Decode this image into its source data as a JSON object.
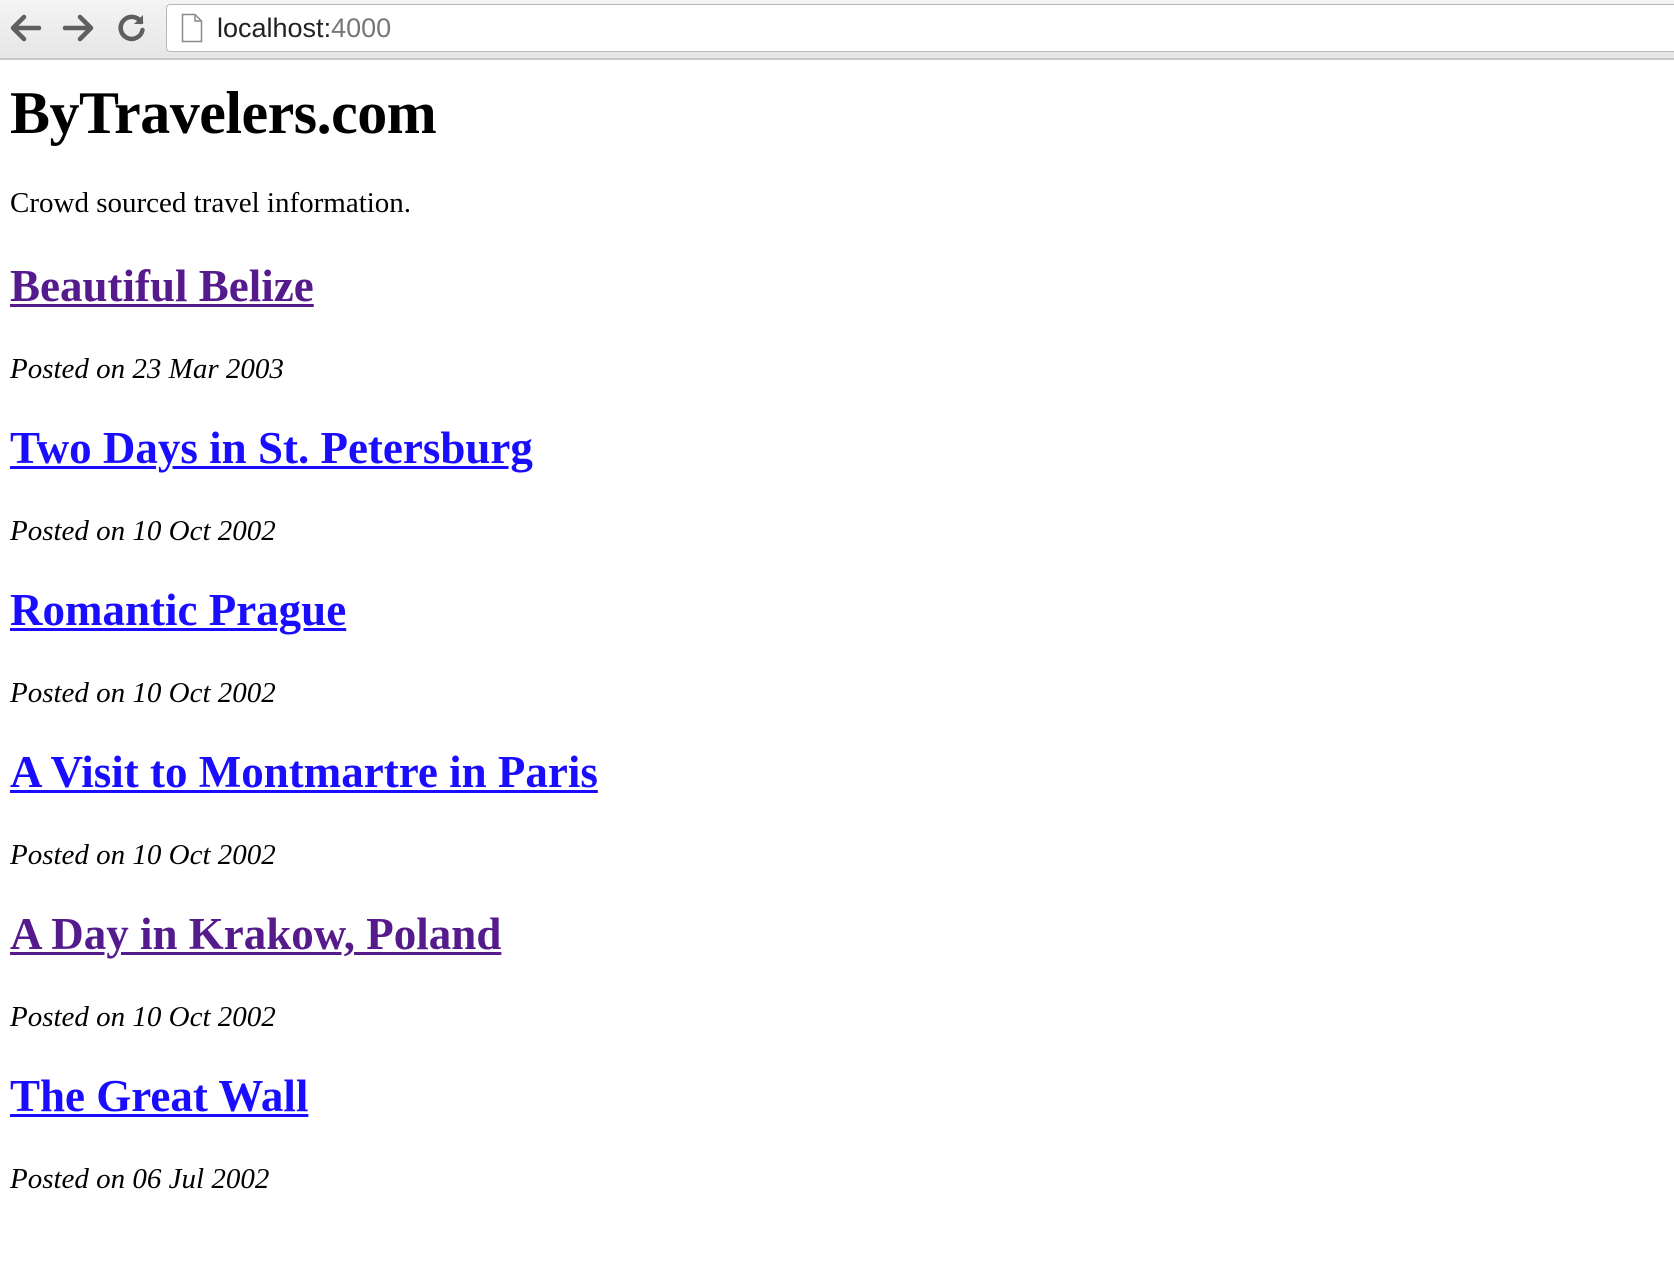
{
  "browser": {
    "url_host": "localhost:",
    "url_port": "4000",
    "icons": [
      "back-arrow-icon",
      "forward-arrow-icon",
      "reload-icon",
      "page-icon"
    ]
  },
  "page": {
    "site_title": "ByTravelers.com",
    "tagline": "Crowd sourced travel information.",
    "colors": {
      "visited_link": "#551a8b",
      "unvisited_link": "#1a0dff",
      "text": "#000000"
    },
    "posts": [
      {
        "title": "Beautiful Belize",
        "date": "Posted on 23 Mar 2003",
        "visited": true
      },
      {
        "title": "Two Days in St. Petersburg",
        "date": "Posted on 10 Oct 2002",
        "visited": false
      },
      {
        "title": "Romantic Prague",
        "date": "Posted on 10 Oct 2002",
        "visited": false
      },
      {
        "title": "A Visit to Montmartre in Paris",
        "date": "Posted on 10 Oct 2002",
        "visited": false
      },
      {
        "title": "A Day in Krakow, Poland",
        "date": "Posted on 10 Oct 2002",
        "visited": true
      },
      {
        "title": "The Great Wall",
        "date": "Posted on 06 Jul 2002",
        "visited": false
      }
    ]
  }
}
